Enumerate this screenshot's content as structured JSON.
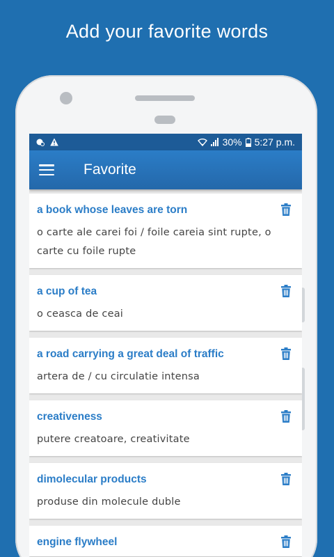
{
  "promo": {
    "headline": "Add your favorite words"
  },
  "status_bar": {
    "battery": "30%",
    "time": "5:27 p.m."
  },
  "app_bar": {
    "title": "Favorite"
  },
  "favorites": [
    {
      "term": "a book whose leaves are torn",
      "translation": "o carte ale carei foi / foile careia sint rupte, o carte cu foile rupte"
    },
    {
      "term": "a cup of tea",
      "translation": "o ceasca de ceai"
    },
    {
      "term": "a road carrying a great deal of traffic",
      "translation": "artera de / cu circulatie intensa"
    },
    {
      "term": "creativeness",
      "translation": "putere creatoare, creativitate"
    },
    {
      "term": "dimolecular products",
      "translation": "produse din molecule duble"
    },
    {
      "term": "engine flywheel",
      "translation": ""
    }
  ],
  "colors": {
    "background": "#1f6fb0",
    "app_bar": "#2b7dc7",
    "accent_text": "#2b7dc7"
  },
  "icons": {
    "menu": "hamburger-icon",
    "delete": "trash-icon"
  }
}
